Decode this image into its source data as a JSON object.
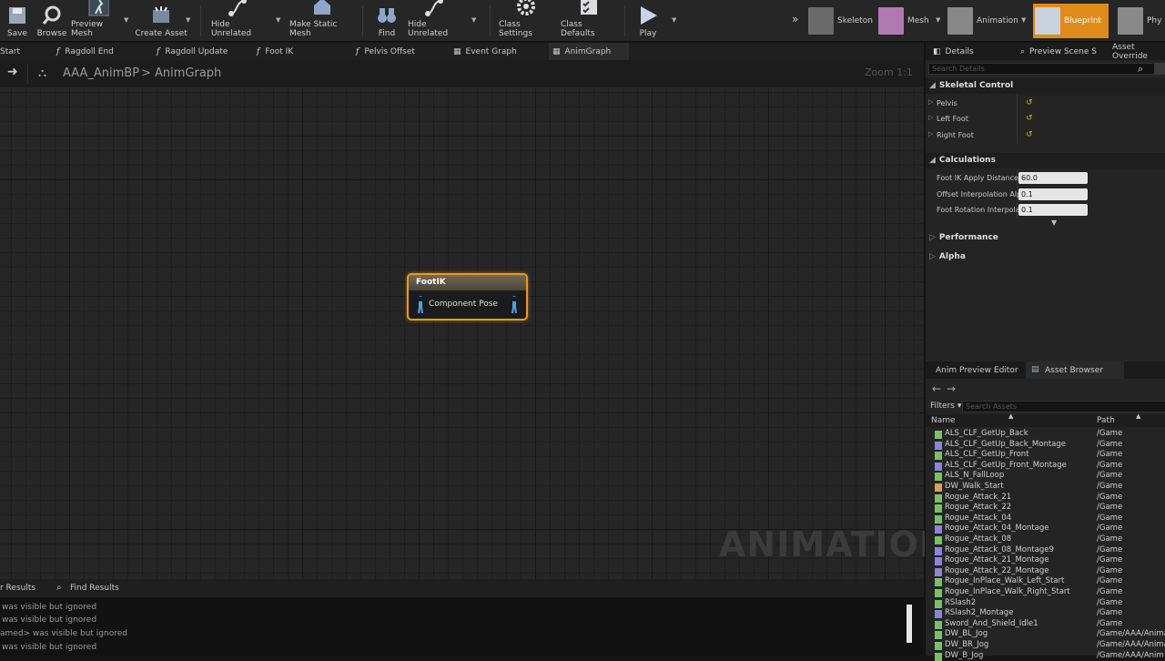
{
  "toolbar": {
    "buttons": [
      "Save",
      "Browse",
      "Preview Mesh",
      "Create Asset",
      "Hide Unrelated",
      "Make Static Mesh",
      "Find",
      "Hide Unrelated",
      "Class Settings",
      "Class Defaults",
      "Play"
    ],
    "modes": [
      "Skeleton",
      "Mesh",
      "Animation",
      "Blueprint",
      "Phy"
    ],
    "active_mode": "Blueprint"
  },
  "tabs": [
    "Start",
    "Ragdoll End",
    "Ragdoll Update",
    "Foot IK",
    "Pelvis Offset",
    "Event Graph",
    "AnimGraph"
  ],
  "breadcrumb": {
    "root": "AAA_AnimBP",
    "sep": ">",
    "current": "AnimGraph"
  },
  "zoom": "Zoom 1:1",
  "node": {
    "title": "FootIK",
    "pin_label": "Component Pose"
  },
  "watermark": "ANIMATION",
  "bottom": {
    "tabs": [
      "r Results",
      "Find Results"
    ],
    "log": [
      "was visible but ignored",
      "was visible but ignored",
      "amed> was visible but ignored",
      "was visible but ignored"
    ]
  },
  "details": {
    "tabs": [
      "Details",
      "Preview Scene S",
      "Asset Override"
    ],
    "search_placeholder": "Search Details",
    "skeletal_control": {
      "label": "Skeletal Control",
      "props": [
        "Pelvis",
        "Left Foot",
        "Right Foot"
      ]
    },
    "calculations": {
      "label": "Calculations",
      "props": [
        {
          "name": "Foot IK Apply Distance",
          "value": "60.0"
        },
        {
          "name": "Offset Interpolation Alpl",
          "value": "0.1"
        },
        {
          "name": "Foot Rotation Interpolati",
          "value": "0.1"
        }
      ]
    },
    "performance": "Performance",
    "alpha": "Alpha"
  },
  "asset_browser": {
    "tabs": [
      "Anim Preview Editor",
      "Asset Browser"
    ],
    "filters": "Filters",
    "search_placeholder": "Search Assets",
    "col_name": "Name",
    "col_path": "Path",
    "rows": [
      {
        "name": "ALS_CLF_GetUp_Back",
        "path": "/Game",
        "color": "#7bbf6a"
      },
      {
        "name": "ALS_CLF_GetUp_Back_Montage",
        "path": "/Game",
        "color": "#8c84d8"
      },
      {
        "name": "ALS_CLF_GetUp_Front",
        "path": "/Game",
        "color": "#7bbf6a"
      },
      {
        "name": "ALS_CLF_GetUp_Front_Montage",
        "path": "/Game",
        "color": "#8c84d8"
      },
      {
        "name": "ALS_N_FallLoop",
        "path": "/Game",
        "color": "#7bbf6a"
      },
      {
        "name": "DW_Walk_Start",
        "path": "/Game",
        "color": "#d8a060"
      },
      {
        "name": "Rogue_Attack_21",
        "path": "/Game",
        "color": "#7bbf6a"
      },
      {
        "name": "Rogue_Attack_22",
        "path": "/Game",
        "color": "#7bbf6a"
      },
      {
        "name": "Rogue_Attack_04",
        "path": "/Game",
        "color": "#7bbf6a"
      },
      {
        "name": "Rogue_Attack_04_Montage",
        "path": "/Game",
        "color": "#8c84d8"
      },
      {
        "name": "Rogue_Attack_08",
        "path": "/Game",
        "color": "#7bbf6a"
      },
      {
        "name": "Rogue_Attack_08_Montage9",
        "path": "/Game",
        "color": "#8c84d8"
      },
      {
        "name": "Rogue_Attack_21_Montage",
        "path": "/Game",
        "color": "#8c84d8"
      },
      {
        "name": "Rogue_Attack_22_Montage",
        "path": "/Game",
        "color": "#8c84d8"
      },
      {
        "name": "Rogue_InPlace_Walk_Left_Start",
        "path": "/Game",
        "color": "#7bbf6a"
      },
      {
        "name": "Rogue_InPlace_Walk_Right_Start",
        "path": "/Game",
        "color": "#7bbf6a"
      },
      {
        "name": "RSlash2",
        "path": "/Game",
        "color": "#7bbf6a"
      },
      {
        "name": "RSlash2_Montage",
        "path": "/Game",
        "color": "#8c84d8"
      },
      {
        "name": "Sword_And_Shield_Idle1",
        "path": "/Game",
        "color": "#7bbf6a"
      },
      {
        "name": "DW_BL_Jog",
        "path": "/Game/AAA/Anima",
        "color": "#7bbf6a"
      },
      {
        "name": "DW_BR_Jog",
        "path": "/Game/AAA/Anima",
        "color": "#7bbf6a"
      },
      {
        "name": "DW_B_Jog",
        "path": "/Game/AAA/Anim",
        "color": "#7bbf6a"
      }
    ]
  }
}
